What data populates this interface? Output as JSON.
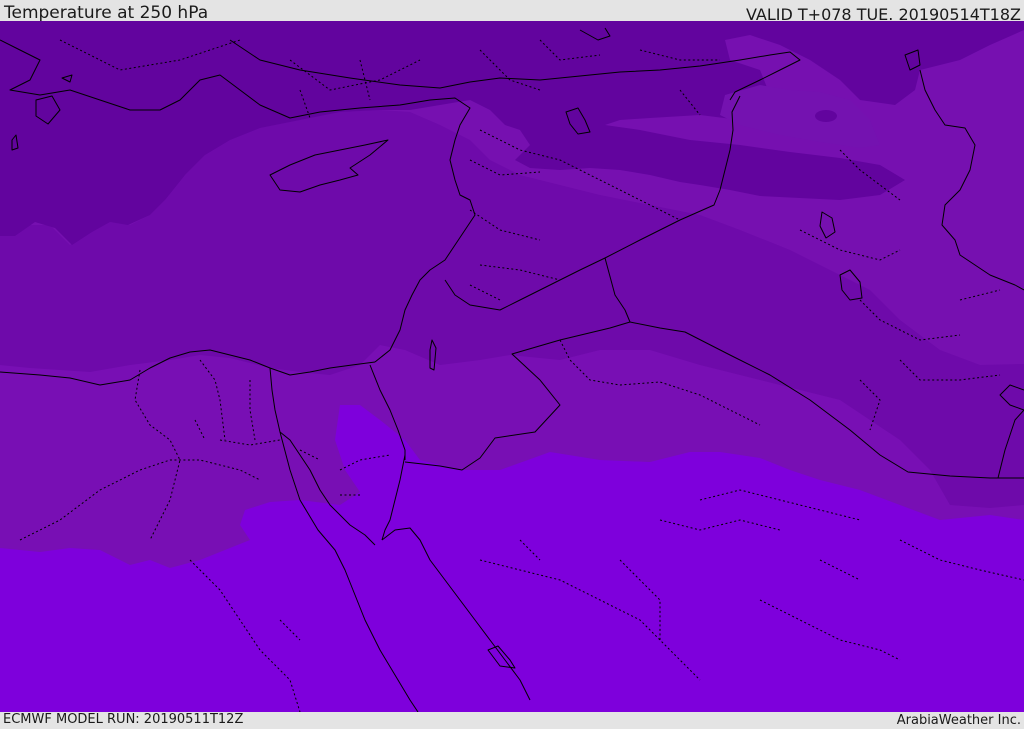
{
  "header": {
    "title": "Temperature at 250 hPa",
    "valid": "VALID T+078 TUE. 20190514T18Z"
  },
  "footer": {
    "model_run": "ECMWF MODEL RUN: 20190511T12Z",
    "credit": "ArabiaWeather Inc."
  },
  "map": {
    "field": "temperature",
    "level": "250 hPa",
    "colors": {
      "coldest": "#62049e",
      "cold": "#6e0aaa",
      "mid": "#780fb4",
      "warm": "#7e00dc",
      "lake": "#6a08a8",
      "border": "#000000"
    }
  }
}
